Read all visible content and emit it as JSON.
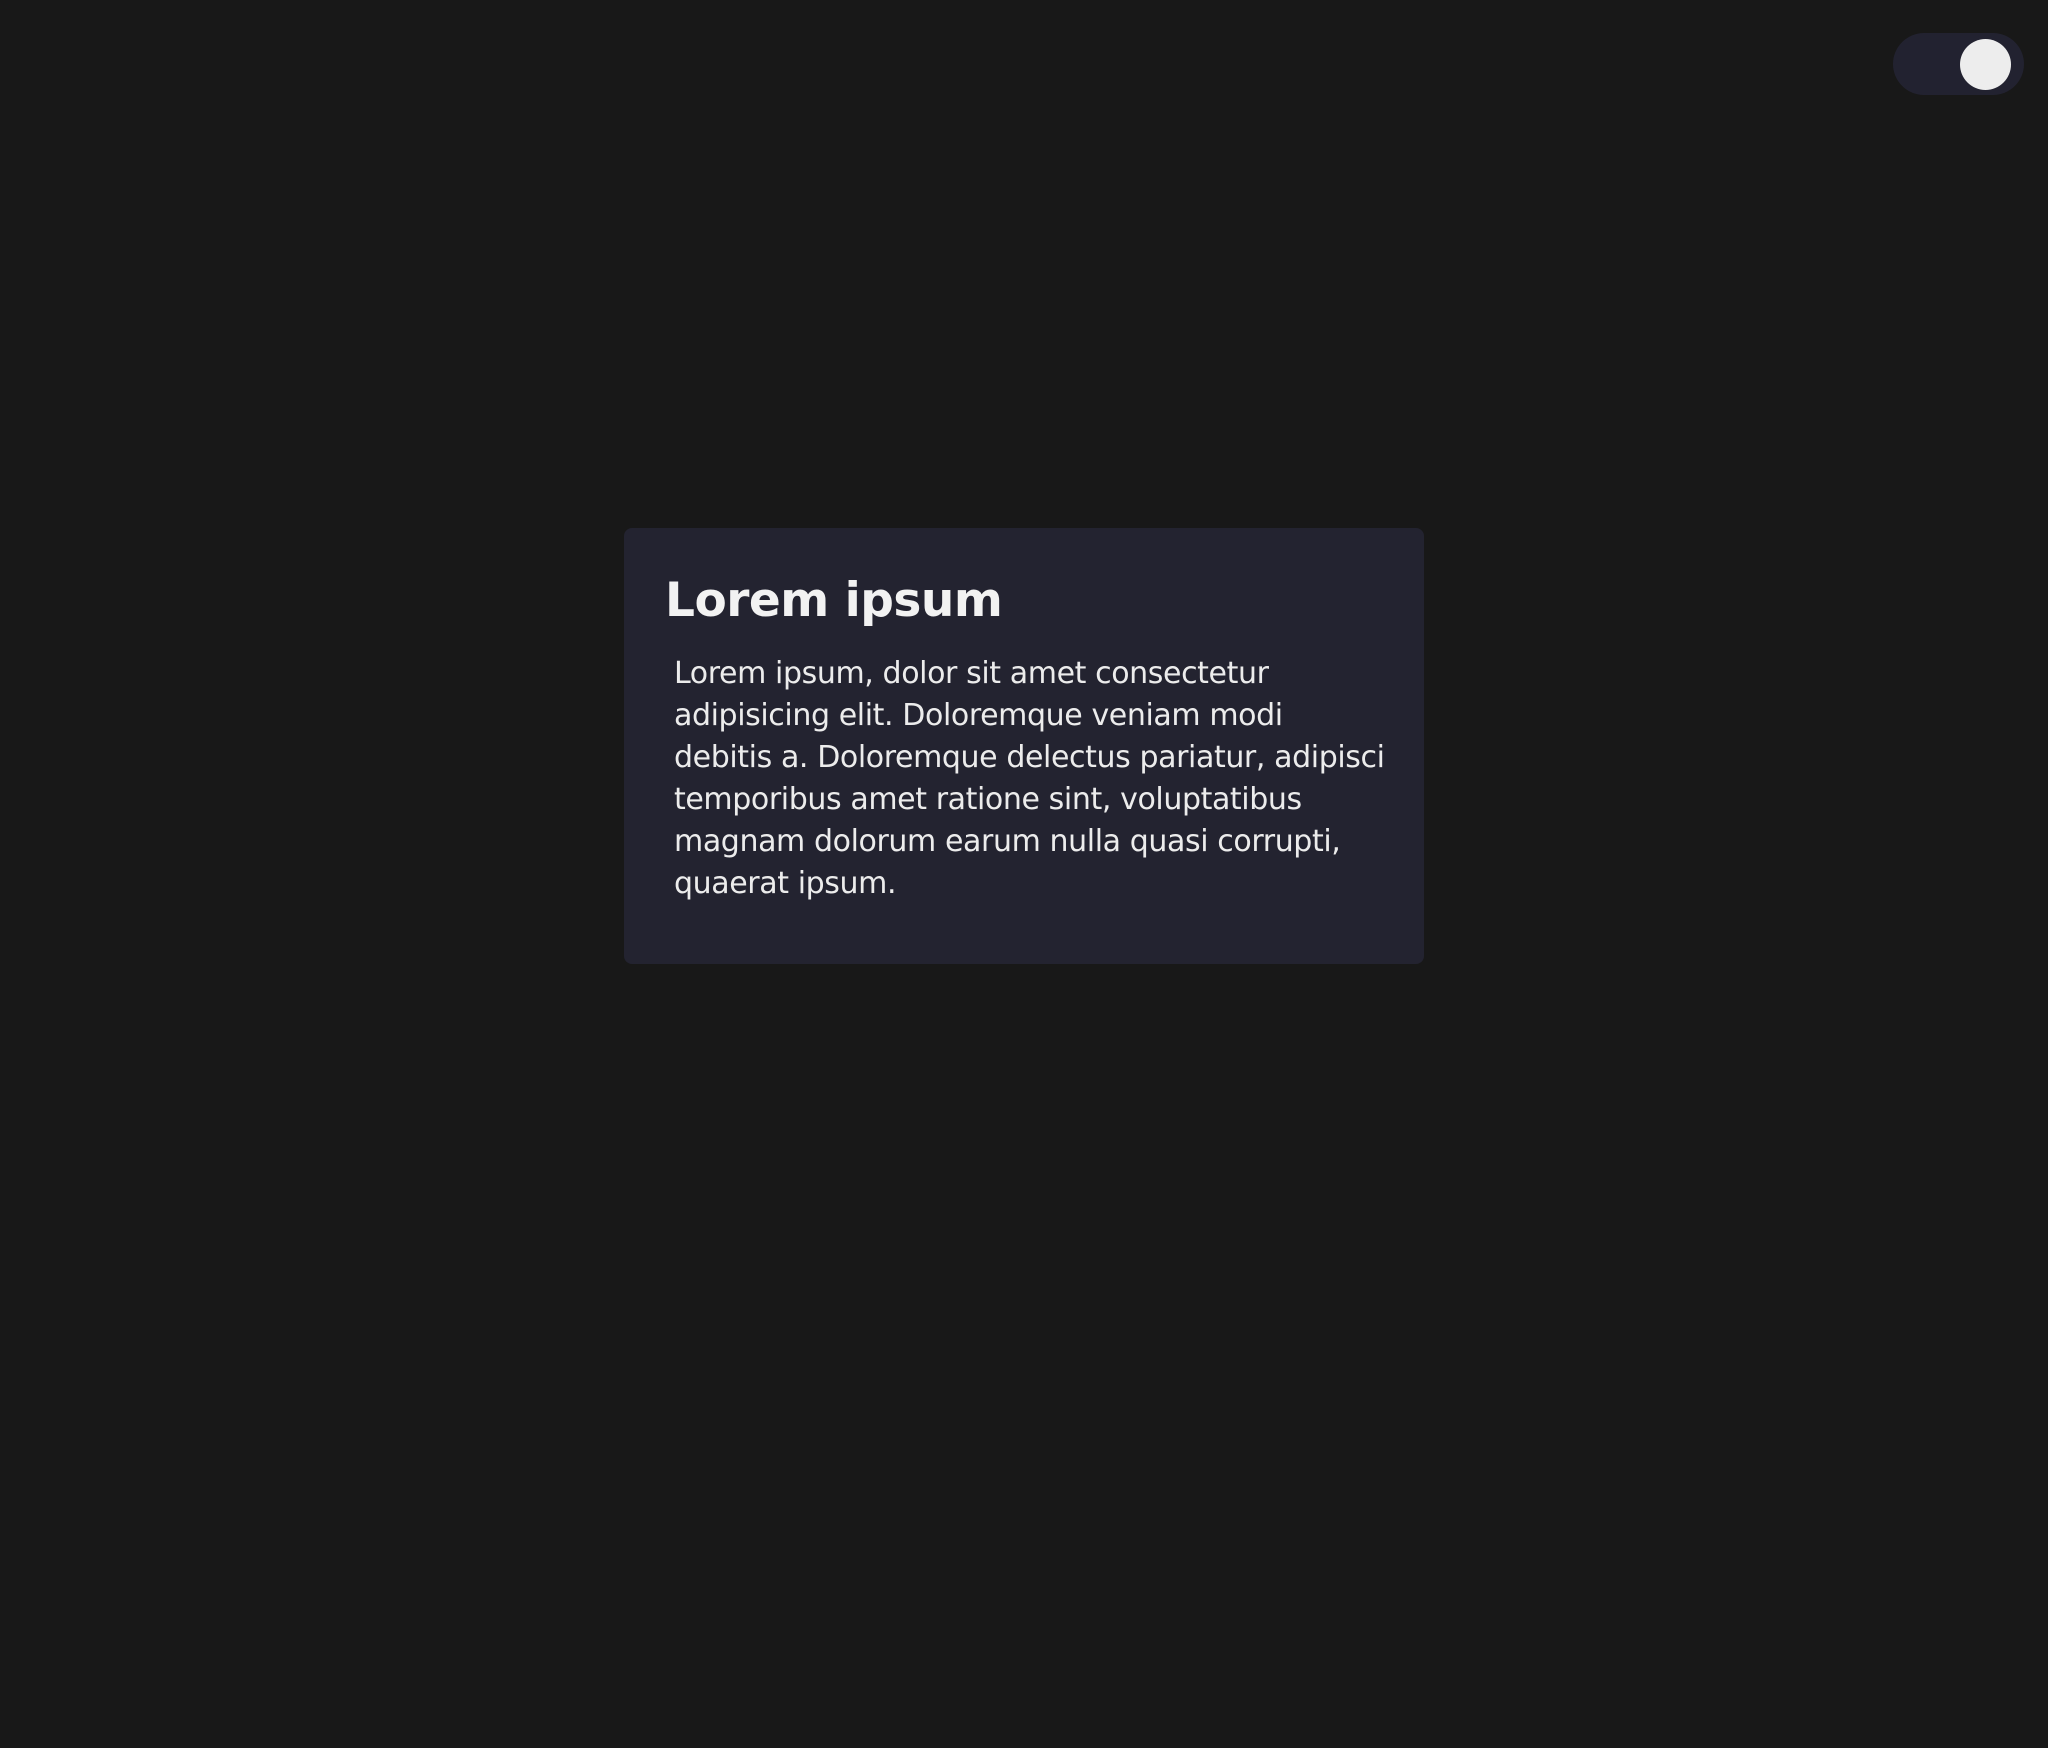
{
  "theme_toggle": {
    "state": "on"
  },
  "card": {
    "title": "Lorem ipsum",
    "body": "Lorem ipsum, dolor sit amet consectetur adipisicing elit. Doloremque veniam modi debitis a. Doloremque delectus pariatur, adipisci temporibus amet ratione sint, voluptatibus magnam dolorum earum nulla quasi corrupti, quaerat ipsum."
  },
  "colors": {
    "page_background": "#181818",
    "card_background": "#232330",
    "toggle_track": "#222230",
    "toggle_knob": "#ededed",
    "text": "#f2f2f2"
  }
}
